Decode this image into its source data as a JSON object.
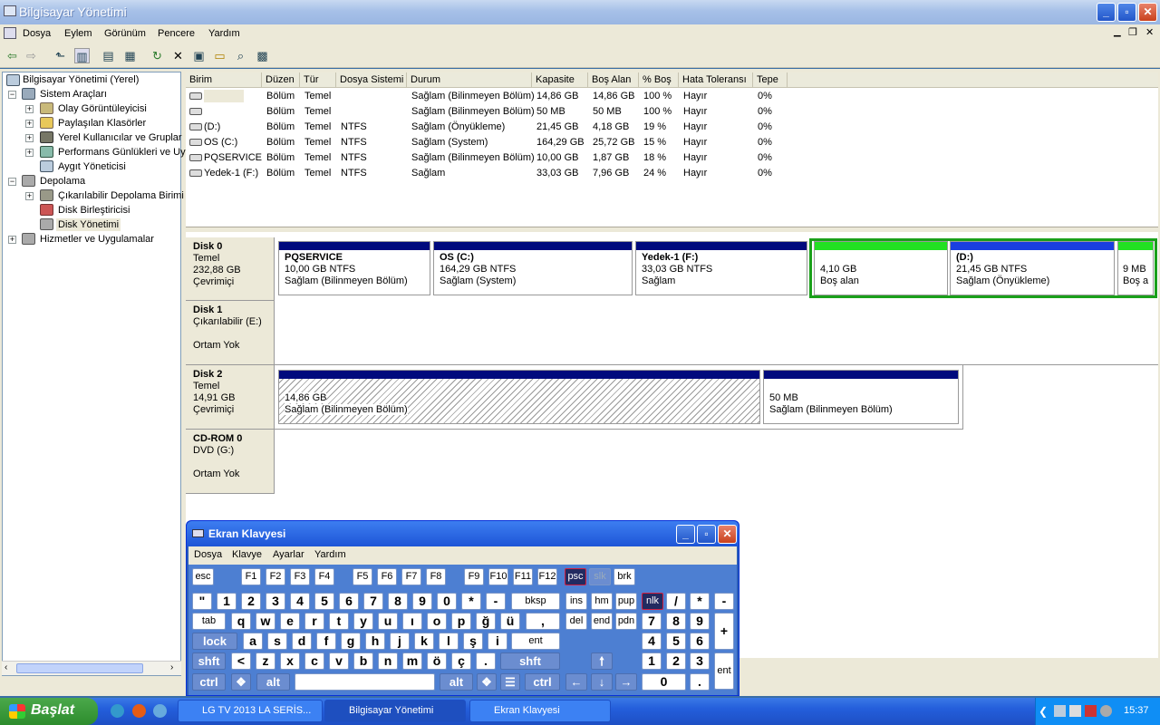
{
  "window": {
    "title": "Bilgisayar Yönetimi"
  },
  "menu": [
    "Dosya",
    "Eylem",
    "Görünüm",
    "Pencere",
    "Yardım"
  ],
  "tree": [
    {
      "label": "Bilgisayar Yönetimi (Yerel)"
    },
    {
      "label": "Sistem Araçları"
    },
    {
      "label": "Olay Görüntüleyicisi"
    },
    {
      "label": "Paylaşılan Klasörler"
    },
    {
      "label": "Yerel Kullanıcılar ve Gruplar"
    },
    {
      "label": "Performans Günlükleri ve Uy"
    },
    {
      "label": "Aygıt Yöneticisi"
    },
    {
      "label": "Depolama"
    },
    {
      "label": "Çıkarılabilir Depolama Birimi"
    },
    {
      "label": "Disk Birleştiricisi"
    },
    {
      "label": "Disk Yönetimi"
    },
    {
      "label": "Hizmetler ve Uygulamalar"
    }
  ],
  "columns": [
    "Birim",
    "Düzen",
    "Tür",
    "Dosya Sistemi",
    "Durum",
    "Kapasite",
    "Boş Alan",
    "% Boş",
    "Hata Toleransı",
    "Tepe"
  ],
  "volumes": [
    [
      "",
      "Bölüm",
      "Temel",
      "",
      "Sağlam (Bilinmeyen Bölüm)",
      "14,86 GB",
      "14,86 GB",
      "100 %",
      "Hayır",
      "0%"
    ],
    [
      "",
      "Bölüm",
      "Temel",
      "",
      "Sağlam (Bilinmeyen Bölüm)",
      "50 MB",
      "50 MB",
      "100 %",
      "Hayır",
      "0%"
    ],
    [
      "(D:)",
      "Bölüm",
      "Temel",
      "NTFS",
      "Sağlam (Önyükleme)",
      "21,45 GB",
      "4,18 GB",
      "19 %",
      "Hayır",
      "0%"
    ],
    [
      "OS (C:)",
      "Bölüm",
      "Temel",
      "NTFS",
      "Sağlam (System)",
      "164,29 GB",
      "25,72 GB",
      "15 %",
      "Hayır",
      "0%"
    ],
    [
      "PQSERVICE",
      "Bölüm",
      "Temel",
      "NTFS",
      "Sağlam (Bilinmeyen Bölüm)",
      "10,00 GB",
      "1,87 GB",
      "18 %",
      "Hayır",
      "0%"
    ],
    [
      "Yedek-1 (F:)",
      "Bölüm",
      "Temel",
      "NTFS",
      "Sağlam",
      "33,03 GB",
      "7,96 GB",
      "24 %",
      "Hayır",
      "0%"
    ]
  ],
  "disks": [
    {
      "name": "Disk 0",
      "type": "Temel",
      "size": "232,88 GB",
      "status": "Çevrimiçi"
    },
    {
      "name": "Disk 1",
      "type": "Çıkarılabilir (E:)",
      "size": "",
      "status": "Ortam Yok"
    },
    {
      "name": "Disk 2",
      "type": "Temel",
      "size": "14,91 GB",
      "status": "Çevrimiçi"
    },
    {
      "name": "CD-ROM 0",
      "type": "DVD (G:)",
      "size": "",
      "status": "Ortam Yok"
    }
  ],
  "partitions": {
    "d0p1": {
      "name": "PQSERVICE",
      "size": "10,00 GB NTFS",
      "status": "Sağlam (Bilinmeyen Bölüm)"
    },
    "d0p2": {
      "name": "OS  (C:)",
      "size": "164,29 GB NTFS",
      "status": "Sağlam (System)"
    },
    "d0p3": {
      "name": "Yedek-1  (F:)",
      "size": "33,03 GB NTFS",
      "status": "Sağlam"
    },
    "d0p4": {
      "name": "",
      "size": "4,10 GB",
      "status": "Boş alan"
    },
    "d0p5": {
      "name": "(D:)",
      "size": "21,45 GB NTFS",
      "status": "Sağlam (Önyükleme)"
    },
    "d0p6": {
      "name": "",
      "size": "9 MB",
      "status": "Boş a"
    },
    "d2p1": {
      "name": "",
      "size": "14,86 GB",
      "status": "Sağlam (Bilinmeyen Bölüm)"
    },
    "d2p2": {
      "name": "",
      "size": "50 MB",
      "status": "Sağlam (Bilinmeyen Bölüm)"
    }
  },
  "osk": {
    "title": "Ekran Klavyesi",
    "menu": [
      "Dosya",
      "Klavye",
      "Ayarlar",
      "Yardım"
    ]
  },
  "taskbar": {
    "start": "Başlat",
    "tasks": [
      "LG TV 2013 LA SERİS...",
      "Bilgisayar Yönetimi",
      "Ekran Klavyesi"
    ],
    "clock": "15:37"
  }
}
